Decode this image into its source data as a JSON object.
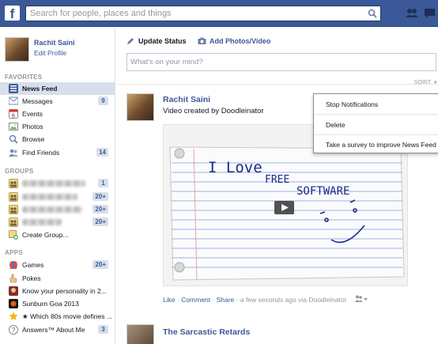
{
  "header": {
    "logo": "f",
    "search_placeholder": "Search for people, places and things"
  },
  "profile": {
    "name": "Rachit Saini",
    "edit_label": "Edit Profile"
  },
  "sidebar": {
    "favorites_heading": "FAVORITES",
    "favorites": [
      {
        "label": "News Feed",
        "icon": "news-feed-icon",
        "active": true
      },
      {
        "label": "Messages",
        "icon": "messages-icon",
        "badge": "9"
      },
      {
        "label": "Events",
        "icon": "events-icon"
      },
      {
        "label": "Photos",
        "icon": "photos-icon"
      },
      {
        "label": "Browse",
        "icon": "browse-icon"
      },
      {
        "label": "Find Friends",
        "icon": "find-friends-icon",
        "badge": "14"
      }
    ],
    "groups_heading": "GROUPS",
    "groups": [
      {
        "badge": "1"
      },
      {
        "badge": "20+"
      },
      {
        "badge": "20+"
      },
      {
        "badge": "20+"
      },
      {
        "label": "Create Group..."
      }
    ],
    "apps_heading": "APPS",
    "apps": [
      {
        "label": "Games",
        "badge": "20+"
      },
      {
        "label": "Pokes"
      },
      {
        "label": "Know your personality in 2..."
      },
      {
        "label": "Sunburn Goa 2013"
      },
      {
        "label": "★ Which 80s movie defines ..."
      },
      {
        "label": "Answers™ About Me",
        "badge": "3"
      }
    ]
  },
  "composer": {
    "update_status": "Update Status",
    "add_photos": "Add Photos/Video",
    "placeholder": "What's on your mind?"
  },
  "feed": {
    "sort_label": "SORT",
    "post": {
      "author": "Rachit Saini",
      "subtitle": "Video created by Doodleinator",
      "video_text": [
        "I Love",
        "FREE",
        "SOFTWARE"
      ],
      "actions": {
        "like": "Like",
        "comment": "Comment",
        "share": "Share",
        "meta": "a few seconds ago via Doodleinator"
      }
    },
    "next_post": {
      "author": "The Sarcastic Retards"
    }
  },
  "menu": {
    "items": [
      "Stop Notifications",
      "Delete",
      "Take a survey to improve News Feed"
    ]
  },
  "colors": {
    "brand": "#3b5998",
    "link": "#3b5998",
    "muted": "#9197a3"
  }
}
